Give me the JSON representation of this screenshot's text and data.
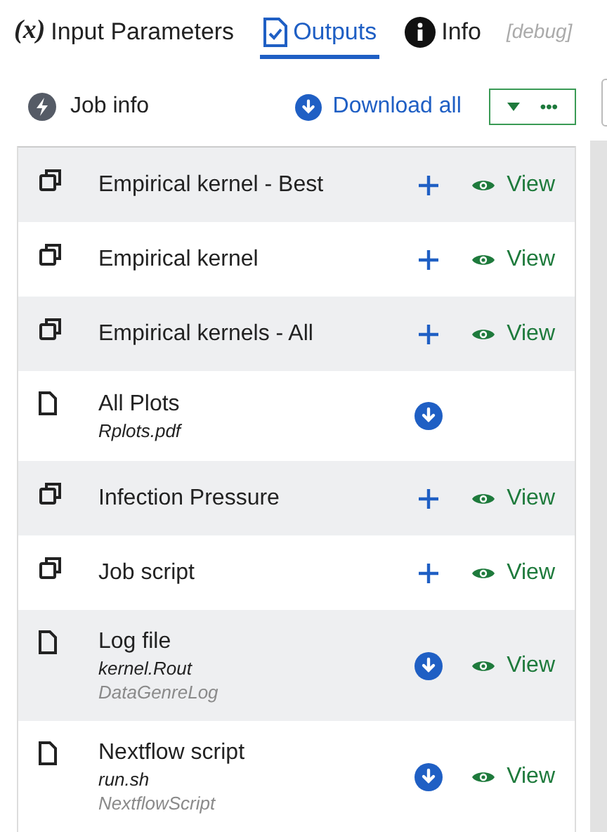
{
  "tabs": [
    {
      "kind": "params",
      "icon_text": "(x)",
      "label": "Input Parameters",
      "selected": false
    },
    {
      "kind": "outputs",
      "label": "Outputs",
      "selected": true
    },
    {
      "kind": "info",
      "label": "Info",
      "selected": false
    }
  ],
  "debug": "[debug]",
  "toolbar": {
    "job_info": "Job info",
    "download_all": "Download all",
    "more": "•••"
  },
  "outputs": [
    {
      "kind": "collection",
      "name": "Empirical kernel - Best",
      "view": "View"
    },
    {
      "kind": "collection",
      "name": "Empirical kernel",
      "view": "View"
    },
    {
      "kind": "collection",
      "name": "Empirical kernels - All",
      "view": "View"
    },
    {
      "kind": "file",
      "name": "All Plots",
      "filename": "Rplots.pdf"
    },
    {
      "kind": "collection",
      "name": "Infection Pressure",
      "view": "View"
    },
    {
      "kind": "collection",
      "name": "Job script",
      "view": "View"
    },
    {
      "kind": "file",
      "name": "Log file",
      "filename": "kernel.Rout",
      "genre": "DataGenreLog",
      "view": "View"
    },
    {
      "kind": "file",
      "name": "Nextflow script",
      "filename": "run.sh",
      "genre": "NextflowScript",
      "view": "View"
    }
  ]
}
